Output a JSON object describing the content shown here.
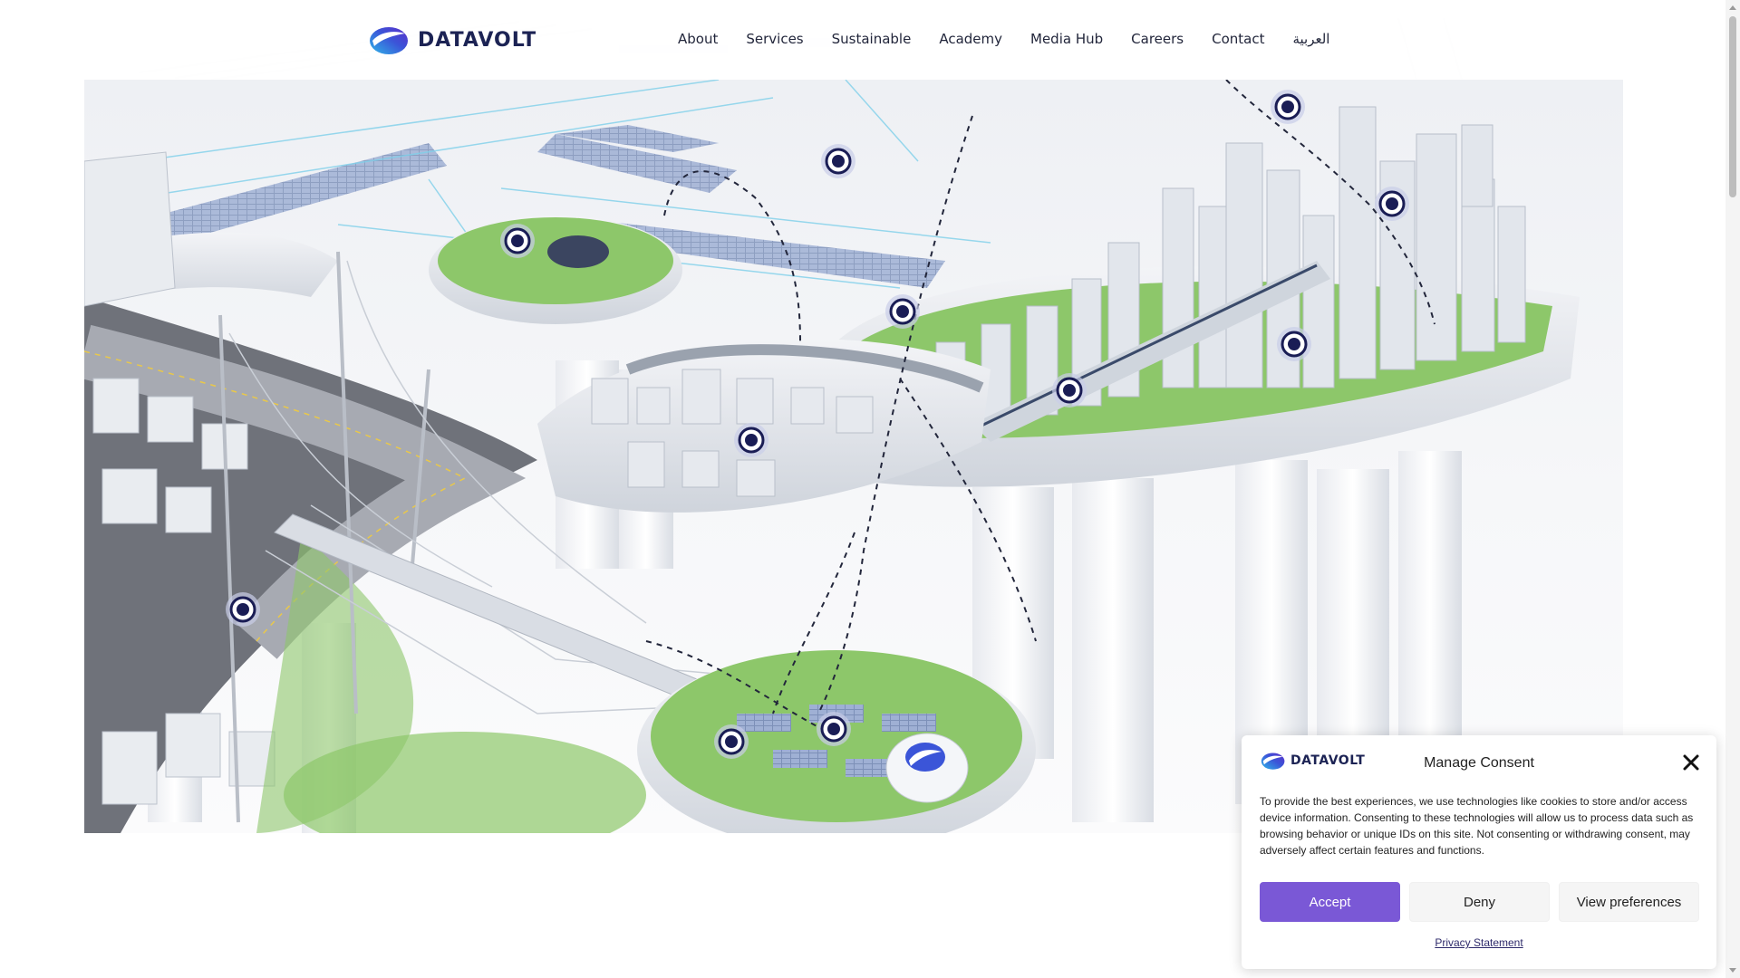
{
  "brand": {
    "name": "DATAVOLT",
    "logo_icon": "datavolt-swoosh-icon",
    "colors": {
      "navy": "#1c2354",
      "blue": "#3b6fd8",
      "purple": "#6b3fd4",
      "accent_button": "#7a58d6"
    }
  },
  "nav": {
    "items": [
      {
        "label": "About"
      },
      {
        "label": "Services"
      },
      {
        "label": "Sustainable"
      },
      {
        "label": "Academy"
      },
      {
        "label": "Media Hub"
      },
      {
        "label": "Careers"
      },
      {
        "label": "Contact"
      },
      {
        "label": "العربية"
      }
    ]
  },
  "hero": {
    "image_icon": "smart-city-illustration-icon",
    "hotspot_icon": "location-hotspot-icon"
  },
  "consent": {
    "title": "Manage Consent",
    "text": "To provide the best experiences, we use technologies like cookies to store and/or access device information. Consenting to these technologies will allow us to process data such as browsing behavior or unique IDs on this site. Not consenting or withdrawing consent, may adversely affect certain features and functions.",
    "accept_label": "Accept",
    "deny_label": "Deny",
    "preferences_label": "View preferences",
    "privacy_link": "Privacy Statement"
  }
}
